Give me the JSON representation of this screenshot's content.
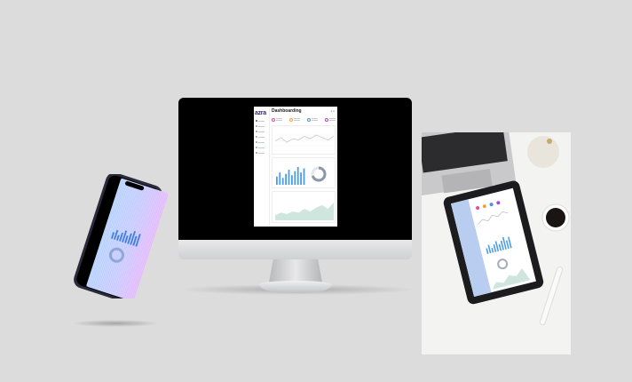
{
  "dashboard": {
    "logo": "azra",
    "title": "Dashboarding",
    "nav_items": [
      "Dashboard",
      "Analytics",
      "Reports",
      "Users",
      "Settings",
      "Messages",
      "Help"
    ],
    "kpis": [
      {
        "name": "kpi-1",
        "color": "#e0509a"
      },
      {
        "name": "kpi-2",
        "color": "#f2a23a"
      },
      {
        "name": "kpi-3",
        "color": "#4a90e2"
      },
      {
        "name": "kpi-4",
        "color": "#a44ad8"
      }
    ],
    "line_card_label": "Statistics",
    "bar_card_label": "Overview",
    "area_card_label": "Total sales",
    "bar_values": [
      6,
      9,
      5,
      8,
      11,
      7,
      10,
      13,
      9,
      12
    ],
    "area_values": [
      4,
      6,
      5,
      7,
      6,
      9,
      7,
      10,
      12,
      9,
      14
    ],
    "line_values": [
      8,
      11,
      7,
      10,
      9,
      12,
      10,
      13,
      11,
      9,
      12
    ],
    "donut_share": 0.7
  },
  "colors": {
    "accent": "#6a3fc9",
    "bar": "#4a9ee8",
    "area": "#cfe6de",
    "phone_blue": "#b8d4ff",
    "phone_purple": "#d9b3ff"
  }
}
